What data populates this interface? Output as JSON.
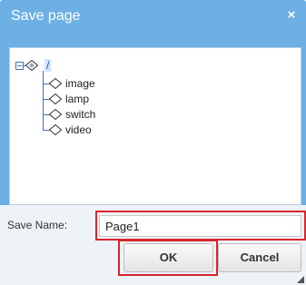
{
  "dialog": {
    "title": "Save page",
    "close_glyph": "×",
    "close_icon": "close-icon"
  },
  "tree": {
    "root": {
      "label": "/",
      "icon": "folder-diamond-icon",
      "expander": "collapse-icon"
    },
    "children": [
      {
        "label": "image",
        "icon": "diamond-icon"
      },
      {
        "label": "lamp",
        "icon": "diamond-icon"
      },
      {
        "label": "switch",
        "icon": "diamond-icon"
      },
      {
        "label": "video",
        "icon": "diamond-icon"
      }
    ]
  },
  "form": {
    "save_name_label": "Save Name:",
    "save_name_value": "Page1"
  },
  "buttons": {
    "ok_label": "OK",
    "cancel_label": "Cancel"
  },
  "colors": {
    "dialog_bg": "#6cb0e4",
    "highlight": "#d9262e",
    "tree_line": "#4a6fb5"
  }
}
